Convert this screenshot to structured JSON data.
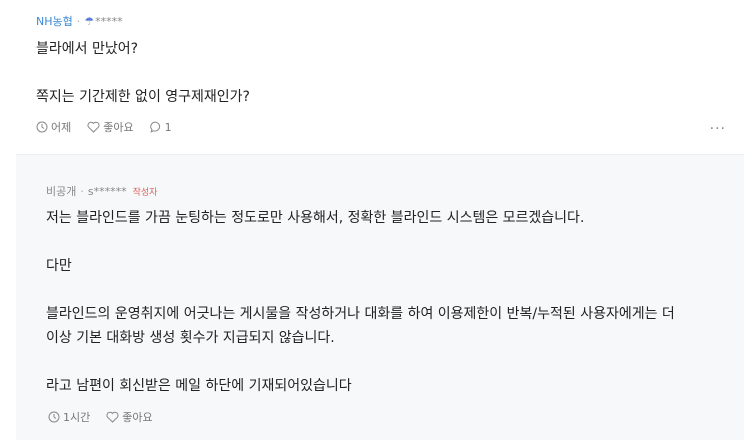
{
  "comment": {
    "company": "NH농협",
    "separator": "·",
    "masked_name": "*****",
    "lines": [
      "블라에서 만났어?",
      "쪽지는 기간제한 없이 영구제재인가?"
    ],
    "time": "어제",
    "like_label": "좋아요",
    "reply_count": "1",
    "more_label": "···"
  },
  "reply": {
    "company": "비공개",
    "separator": "·",
    "masked_name": "s******",
    "author_tag": "작성자",
    "lines": [
      "저는 블라인드를 가끔 눈팅하는 정도로만 사용해서, 정확한 블라인드 시스템은 모르겠습니다.",
      "다만",
      "블라인드의 운영취지에 어긋나는 게시물을 작성하거나 대화를 하여 이용제한이 반복/누적된 사용자에게는 더",
      "이상 기본 대화방 생성 횟수가 지급되지 않습니다.",
      "라고 남편이 회신받은 메일 하단에 기재되어있습니다"
    ],
    "time": "1시간",
    "like_label": "좋아요"
  },
  "colors": {
    "company": "#3a8ad6",
    "author_tag": "#e0635c",
    "reply_bg": "#f7f8fa"
  },
  "icons": {
    "badge": "umbrella-icon",
    "time": "clock-icon",
    "like": "heart-icon",
    "reply": "speech-bubble-icon",
    "more": "more-dots-icon"
  }
}
